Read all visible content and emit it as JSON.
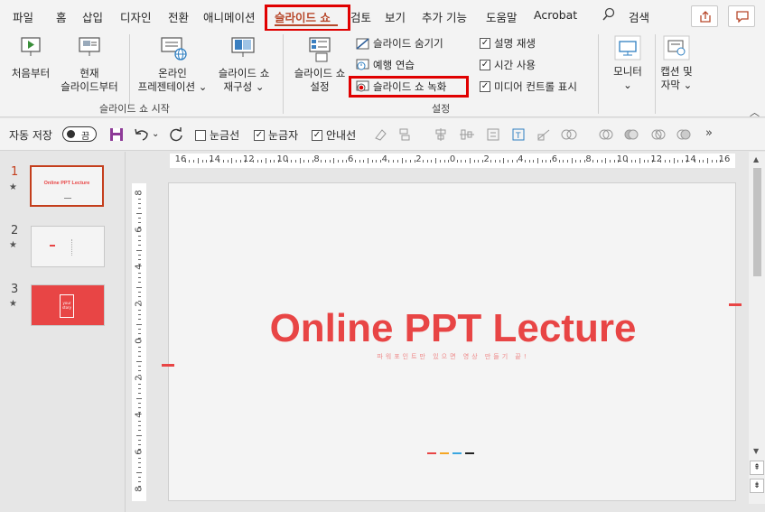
{
  "tabs": [
    "파일",
    "홈",
    "삽입",
    "디자인",
    "전환",
    "애니메이션",
    "슬라이드 쇼",
    "검토",
    "보기",
    "추가 기능",
    "도움말",
    "Acrobat",
    "검색"
  ],
  "ribbon": {
    "start_group": {
      "from_beginning": "처음부터",
      "from_current_1": "현재",
      "from_current_2": "슬라이드부터",
      "online_1": "온라인",
      "online_2": "프레젠테이션",
      "custom_1": "슬라이드 쇼",
      "custom_2": "재구성",
      "label": "슬라이드 쇼 시작"
    },
    "setup_group": {
      "setup_1": "슬라이드 쇼",
      "setup_2": "설정",
      "hide_slide": "슬라이드 숨기기",
      "rehearse": "예행 연습",
      "record": "슬라이드 쇼 녹화",
      "play_narration": "설명 재생",
      "use_timings": "시간 사용",
      "show_media": "미디어 컨트롤 표시",
      "label": "설정"
    },
    "monitor": "모니터",
    "captions_1": "캡션 및",
    "captions_2": "자막"
  },
  "qat": {
    "autosave": "자동 저장",
    "autosave_state": "끔",
    "gridlines": "눈금선",
    "ruler": "눈금자",
    "guides": "안내선"
  },
  "slides": [
    {
      "num": "1",
      "star": "★",
      "thumb_title": "Online PPT Lecture"
    },
    {
      "num": "2",
      "star": "★"
    },
    {
      "num": "3",
      "star": "★",
      "thumb_title": "your story"
    }
  ],
  "ruler_labels": [
    "16",
    "14",
    "12",
    "10",
    "8",
    "6",
    "4",
    "2",
    "0",
    "2",
    "4",
    "6",
    "8",
    "10",
    "12",
    "14",
    "16"
  ],
  "vruler_labels": [
    "8",
    "6",
    "4",
    "2",
    "0",
    "2",
    "4",
    "6",
    "8"
  ],
  "slide": {
    "title": "Online PPT Lecture",
    "subtitle": "파워포인트만 있으면 영상 만들기 끝!"
  },
  "colors": {
    "accent": "#e84545",
    "highlight_box": "#e00000",
    "ribbon_bg": "#f3f3f3",
    "bar_colors": [
      "#e84545",
      "#f5a623",
      "#3aa6e0",
      "#222222"
    ]
  }
}
